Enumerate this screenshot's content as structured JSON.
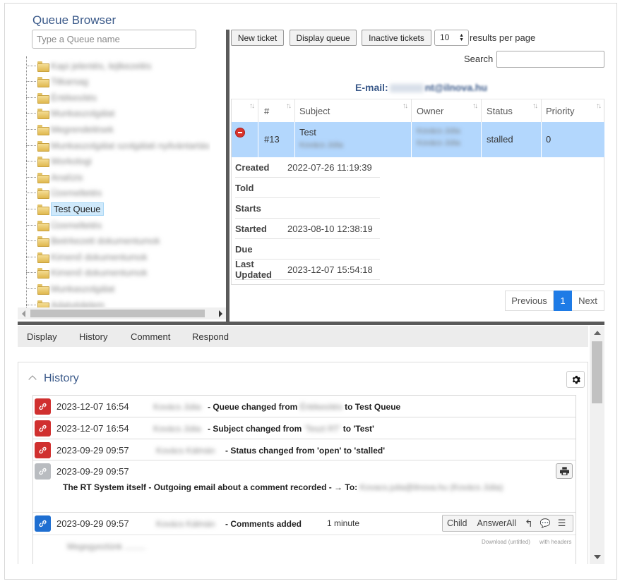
{
  "queue_browser": {
    "title": "Queue Browser",
    "search_placeholder": "Type a Queue name",
    "items": [
      {
        "label": "Kapi jelentés, lejtkezelés",
        "blurred": true
      },
      {
        "label": "Titkarsag",
        "blurred": true
      },
      {
        "label": "Értékesítés",
        "blurred": true
      },
      {
        "label": "Munkaszolgálat",
        "blurred": true
      },
      {
        "label": "Megrendelések",
        "blurred": true
      },
      {
        "label": "Munkaszolgálat szolgálati nyilvántartás",
        "blurred": true
      },
      {
        "label": "Workologi",
        "blurred": true
      },
      {
        "label": "Analízis",
        "blurred": true
      },
      {
        "label": "Üzemeltetés",
        "blurred": true
      },
      {
        "label": "Test Queue",
        "blurred": false,
        "selected": true
      },
      {
        "label": "Üzemeltetés",
        "blurred": true
      },
      {
        "label": "Beérkezett dokumentumok",
        "blurred": true
      },
      {
        "label": "Kimenő dokumentumok",
        "blurred": true
      },
      {
        "label": "Kimenő dokumentumok",
        "blurred": true
      },
      {
        "label": "Munkaszolgálat",
        "blurred": true
      },
      {
        "label": "Adatvédelem",
        "blurred": true
      }
    ]
  },
  "toolbar": {
    "new_ticket": "New ticket",
    "display_queue": "Display queue",
    "inactive_tickets": "Inactive tickets",
    "per_page_value": "10",
    "per_page_label": "results per page",
    "search_label": "Search",
    "search_value": ""
  },
  "queue_title": {
    "prefix": "E-mail:",
    "blurred": "",
    "suffix": "nt@ilnova.hu"
  },
  "table": {
    "headers": [
      "#",
      "Subject",
      "Owner",
      "Status",
      "Priority"
    ],
    "row": {
      "id": "#13",
      "subject": "Test",
      "subject_requestor": "Kovács Júlia",
      "owner_line1": "Kovács Júlia",
      "owner_line2": "Kovács Júlia",
      "status": "stalled",
      "priority": "0"
    },
    "details": [
      {
        "key": "Created",
        "value": "2022-07-26 11:19:39"
      },
      {
        "key": "Told",
        "value": ""
      },
      {
        "key": "Starts",
        "value": ""
      },
      {
        "key": "Started",
        "value": "2023-08-10 12:38:19"
      },
      {
        "key": "Due",
        "value": ""
      },
      {
        "key": "Last Updated",
        "value": "2023-12-07 15:54:18"
      }
    ]
  },
  "pagination": {
    "previous": "Previous",
    "page": "1",
    "next": "Next"
  },
  "bottom_tabs": [
    "Display",
    "History",
    "Comment",
    "Respond"
  ],
  "history": {
    "title": "History",
    "entries": [
      {
        "date": "2023-12-07 16:54",
        "who": "Kovács Júlia",
        "desc_pre": "- Queue changed from",
        "desc_blur": "Értékesítés",
        "desc_post": "to Test Queue",
        "color": "#d0302f"
      },
      {
        "date": "2023-12-07 16:54",
        "who": "Kovács Júlia",
        "desc_pre": "- Subject changed from",
        "desc_blur": "'Teszt RT'",
        "desc_post": "to 'Test'",
        "color": "#d0302f"
      },
      {
        "date": "2023-09-29 09:57",
        "who": "Kovács Kálmán",
        "desc_pre": "- Status changed from 'open' to 'stalled'",
        "desc_blur": "",
        "desc_post": "",
        "color": "#d0302f"
      },
      {
        "date": "2023-09-29 09:57",
        "who": "",
        "desc_pre": "The RT System itself - Outgoing email about a comment recorded - → To:",
        "desc_blur": "Kovacs.julia@ilnova.hu (Kovács Júlia)",
        "desc_post": "",
        "color": "#b9bcc0"
      },
      {
        "date": "2023-09-29 09:57",
        "who": "Kovács Kálmán",
        "desc_pre": "- Comments added",
        "desc_blur": "",
        "desc_post": "",
        "time": "1 minute",
        "color": "#1f6fd1"
      }
    ],
    "comment_tools": {
      "child": "Child",
      "answer_all": "AnswerAll"
    },
    "download_label": "Download (untitled)",
    "headers_label": "with headers",
    "preview_text": "Megegyeztünk ........."
  }
}
